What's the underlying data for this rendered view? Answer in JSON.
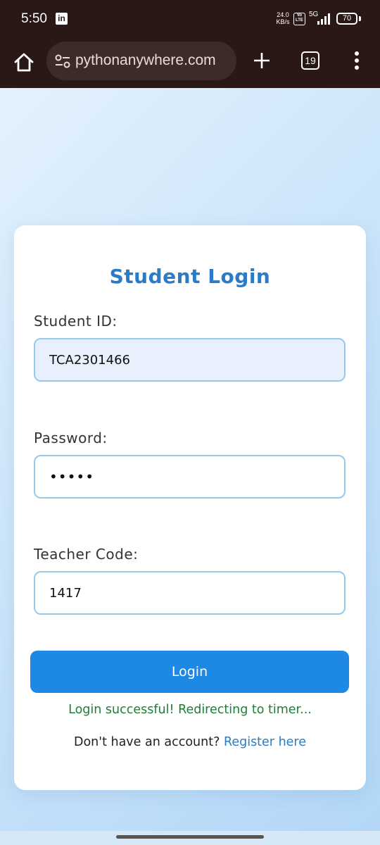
{
  "status_bar": {
    "time": "5:50",
    "notification_icon": "linkedin-icon",
    "notification_text": "in",
    "net_speed_value": "24.0",
    "net_speed_unit": "KB/s",
    "volte_top": "Vo",
    "volte_bottom": "LTE",
    "network_type": "5G",
    "battery": "70"
  },
  "browser": {
    "url": "pythonanywhere.com",
    "tab_count": "19"
  },
  "login": {
    "title": "Student Login",
    "student_id_label": "Student ID:",
    "student_id_value": "TCA2301466",
    "password_label": "Password:",
    "password_value": "•••••",
    "teacher_code_label": "Teacher Code:",
    "teacher_code_value": "1417",
    "login_button": "Login",
    "status_message": "Login successful! Redirecting to timer...",
    "register_prompt": "Don't have an account?",
    "register_link": "Register here"
  },
  "colors": {
    "accent": "#1e88e5",
    "title": "#2a7bc8",
    "success": "#1e7e34",
    "browser_chrome": "#2a1816"
  }
}
